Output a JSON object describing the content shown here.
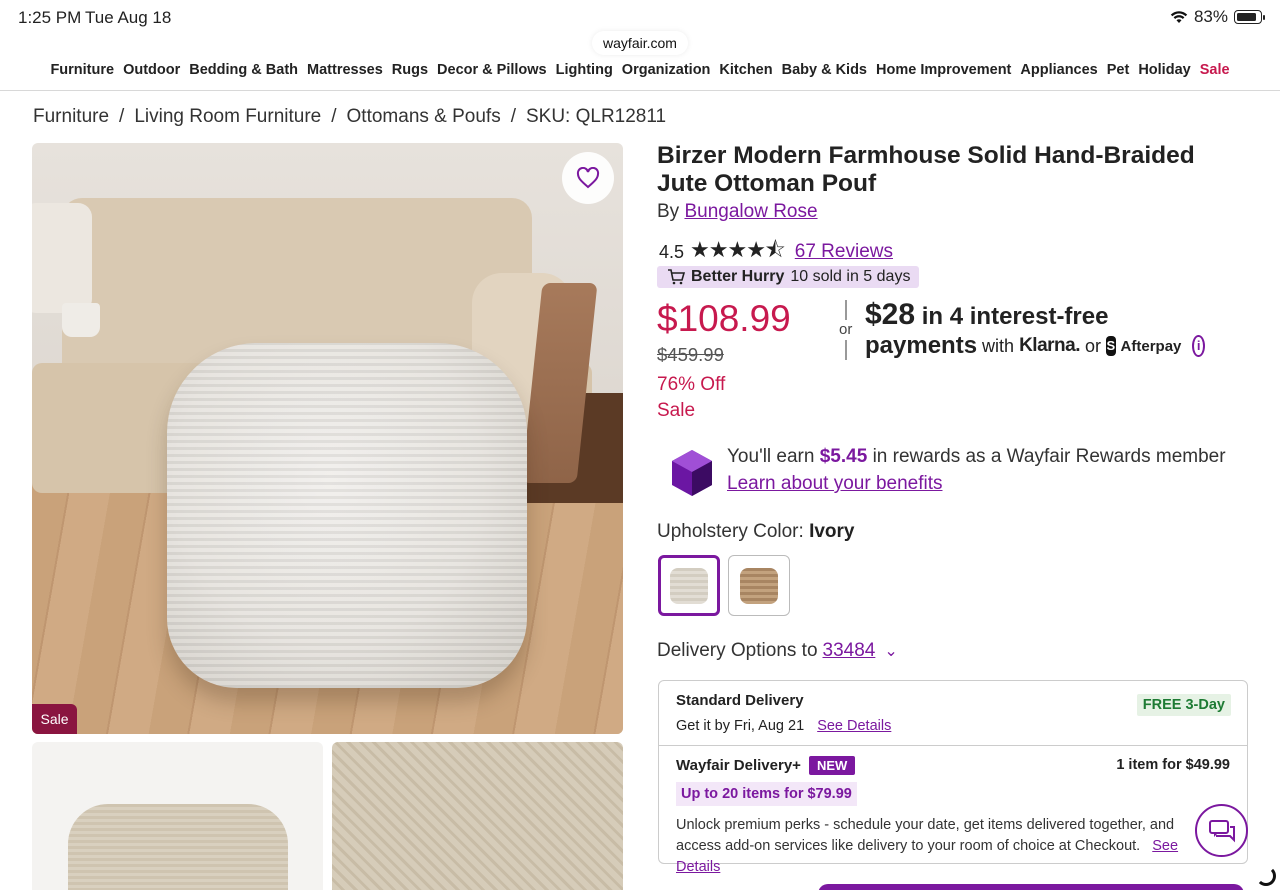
{
  "status_bar": {
    "time": "1:25 PM",
    "date": "Tue Aug 18",
    "battery": "83%"
  },
  "browser": {
    "url": "wayfair.com"
  },
  "nav": {
    "items": [
      "Furniture",
      "Outdoor",
      "Bedding & Bath",
      "Mattresses",
      "Rugs",
      "Decor & Pillows",
      "Lighting",
      "Organization",
      "Kitchen",
      "Baby & Kids",
      "Home Improvement",
      "Appliances",
      "Pet",
      "Holiday"
    ],
    "sale": "Sale"
  },
  "breadcrumb": {
    "items": [
      "Furniture",
      "Living Room Furniture",
      "Ottomans & Poufs"
    ],
    "sku": "SKU: QLR12811",
    "separator": "/"
  },
  "gallery": {
    "sale_badge": "Sale"
  },
  "product": {
    "title": "Birzer Modern Farmhouse Solid Hand-Braided Jute Ottoman Pouf",
    "by": "By",
    "brand": "Bungalow Rose",
    "rating": "4.5",
    "stars": "★★★★⯪",
    "reviews": "67 Reviews",
    "hurry_label": "Better Hurry",
    "hurry_detail": "10 sold in 5 days"
  },
  "pricing": {
    "price": "$108.99",
    "was_price": "$459.99",
    "discount": "76% Off",
    "sale_label": "Sale",
    "or": "or",
    "installment_amount": "$28",
    "installment_text": "in 4 interest-free",
    "payments": "payments",
    "with": "with",
    "klarna": "Klarna.",
    "or2": "or",
    "afterpay": "Afterpay"
  },
  "rewards": {
    "earn_prefix": "You'll earn",
    "amount": "$5.45",
    "earn_suffix": "in rewards as a Wayfair Rewards member",
    "learn": "Learn about your benefits"
  },
  "options": {
    "label": "Upholstery Color:",
    "selected": "Ivory"
  },
  "delivery": {
    "label": "Delivery Options to",
    "zip": "33484",
    "standard_title": "Standard Delivery",
    "standard_get": "Get it by Fri, Aug 21",
    "see_details": "See Details",
    "free_badge": "FREE 3-Day",
    "plus_title": "Wayfair Delivery+",
    "new_badge": "NEW",
    "one_item": "1 item for $49.99",
    "upto": "Up to 20 items for $79.99",
    "unlock": "Unlock premium perks - schedule your date, get items delivered together, and access add-on services like delivery to your room of choice at Checkout.",
    "see_details2": "See Details"
  },
  "colors": {
    "brand_purple": "#7b189f",
    "sale_red": "#c7194e"
  }
}
